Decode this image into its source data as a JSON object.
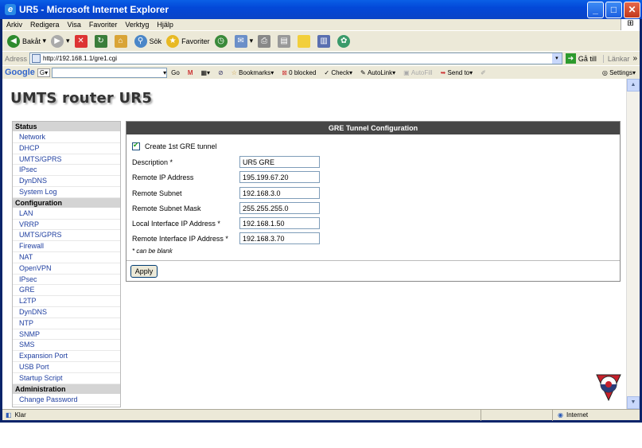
{
  "window": {
    "title": "UR5 - Microsoft Internet Explorer",
    "min": "_",
    "max": "□",
    "close": "✕"
  },
  "menu": [
    "Arkiv",
    "Redigera",
    "Visa",
    "Favoriter",
    "Verktyg",
    "Hjälp"
  ],
  "toolbar": {
    "back": "Bakåt",
    "search": "Sök",
    "favorites": "Favoriter"
  },
  "address": {
    "label": "Adress",
    "url": "http://192.168.1.1/gre1.cgi",
    "go": "Gå till",
    "links": "Länkar",
    "more": "»"
  },
  "google_bar": {
    "logo": "Google",
    "go": "Go",
    "bookmarks": "Bookmarks",
    "blocked": "0 blocked",
    "check": "Check",
    "autolink": "AutoLink",
    "autofill": "AutoFill",
    "send_to": "Send to",
    "settings": "Settings"
  },
  "page": {
    "brand": "UMTS router UR5"
  },
  "sidebar": {
    "sections": [
      {
        "title": "Status",
        "items": [
          "Network",
          "DHCP",
          "UMTS/GPRS",
          "IPsec",
          "DynDNS",
          "System Log"
        ]
      },
      {
        "title": "Configuration",
        "items": [
          "LAN",
          "VRRP",
          "UMTS/GPRS",
          "Firewall",
          "NAT",
          "OpenVPN",
          "IPsec",
          "GRE",
          "L2TP",
          "DynDNS",
          "NTP",
          "SNMP",
          "SMS",
          "Expansion Port",
          "USB Port",
          "Startup Script"
        ]
      },
      {
        "title": "Administration",
        "items": [
          "Change Password"
        ]
      }
    ]
  },
  "panel": {
    "title": "GRE Tunnel Configuration",
    "checkbox_label": "Create 1st GRE tunnel",
    "fields": [
      {
        "label": "Description *",
        "value": "UR5 GRE"
      },
      {
        "label": "Remote IP Address",
        "value": "195.199.67.20"
      },
      {
        "label": "Remote Subnet",
        "value": "192.168.3.0"
      },
      {
        "label": "Remote Subnet Mask",
        "value": "255.255.255.0"
      },
      {
        "label": "Local Interface IP Address *",
        "value": "192.168.1.50"
      },
      {
        "label": "Remote Interface IP Address *",
        "value": "192.168.3.70"
      }
    ],
    "note": "* can be blank",
    "apply": "Apply"
  },
  "status": {
    "left": "Klar",
    "zone": "Internet"
  }
}
